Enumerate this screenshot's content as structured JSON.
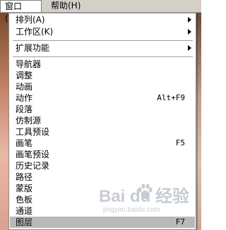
{
  "menubar": {
    "window_label": "窗口(W)",
    "help_label": "帮助(H)"
  },
  "menu": {
    "group1": [
      {
        "label": "排列(A)",
        "submenu": true
      },
      {
        "label": "工作区(K)",
        "submenu": true
      }
    ],
    "group2": [
      {
        "label": "扩展功能",
        "submenu": true
      }
    ],
    "group3": [
      {
        "label": "导航器",
        "shortcut": ""
      },
      {
        "label": "调整",
        "shortcut": ""
      },
      {
        "label": "动画",
        "shortcut": ""
      },
      {
        "label": "动作",
        "shortcut": "Alt+F9"
      },
      {
        "label": "段落",
        "shortcut": ""
      },
      {
        "label": "仿制源",
        "shortcut": ""
      },
      {
        "label": "工具预设",
        "shortcut": ""
      },
      {
        "label": "画笔",
        "shortcut": "F5"
      },
      {
        "label": "画笔预设",
        "shortcut": ""
      },
      {
        "label": "历史记录",
        "shortcut": ""
      },
      {
        "label": "路径",
        "shortcut": ""
      },
      {
        "label": "蒙版",
        "shortcut": ""
      },
      {
        "label": "色板",
        "shortcut": ""
      },
      {
        "label": "通道",
        "shortcut": ""
      },
      {
        "label": "图层",
        "shortcut": "F7",
        "highlighted": true
      }
    ]
  },
  "watermark": {
    "logo_text": "Bai du 经验",
    "url_text": "jingyan.baidu.com"
  },
  "colors": {
    "menubar_bg": "#d4d0c8",
    "menu_bg": "#ffffff",
    "highlight_bg": "#b9b9b9"
  }
}
